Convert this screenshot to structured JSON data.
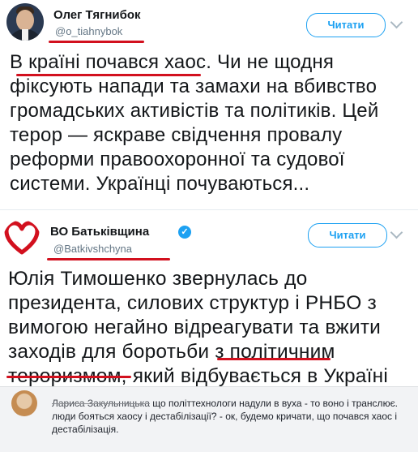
{
  "tweets": [
    {
      "name": "Олег Тягнибок",
      "handle": "@o_tiahnybok",
      "follow_label": "Читати",
      "text": "В країні почався хаос. Чи не щодня фіксують напади та замахи на вбивство громадських активістів та політиків. Цей терор — яскраве свідчення провалу реформи правоохоронної та судової системи. Українці почуваються..."
    },
    {
      "name": "ВО Батьківщина",
      "handle": "@Batkivshchyna",
      "follow_label": "Читати",
      "verified": true,
      "text": "Юлія Тимошенко звернулась до президента, силових структур і РНБО з вимогою негайно відреагувати та вжити заходів для боротьби з політичним тероризмом, який відбувається в Україні"
    }
  ],
  "comment": {
    "author": "Лариса Закульницька",
    "text": "що політтехнологи надули в вуха - то воно і транслює. люди бояться хаосу і дестабілізації? - ок, будемо кричати, що почався хаос і дестабілізація."
  },
  "colors": {
    "accent": "#1da1f2",
    "annotation_red": "#d2101e",
    "verified_blue": "#1da1f2"
  },
  "icons": [
    "avatar-photo",
    "heart-logo-icon",
    "verified-icon",
    "chevron-down-icon"
  ]
}
